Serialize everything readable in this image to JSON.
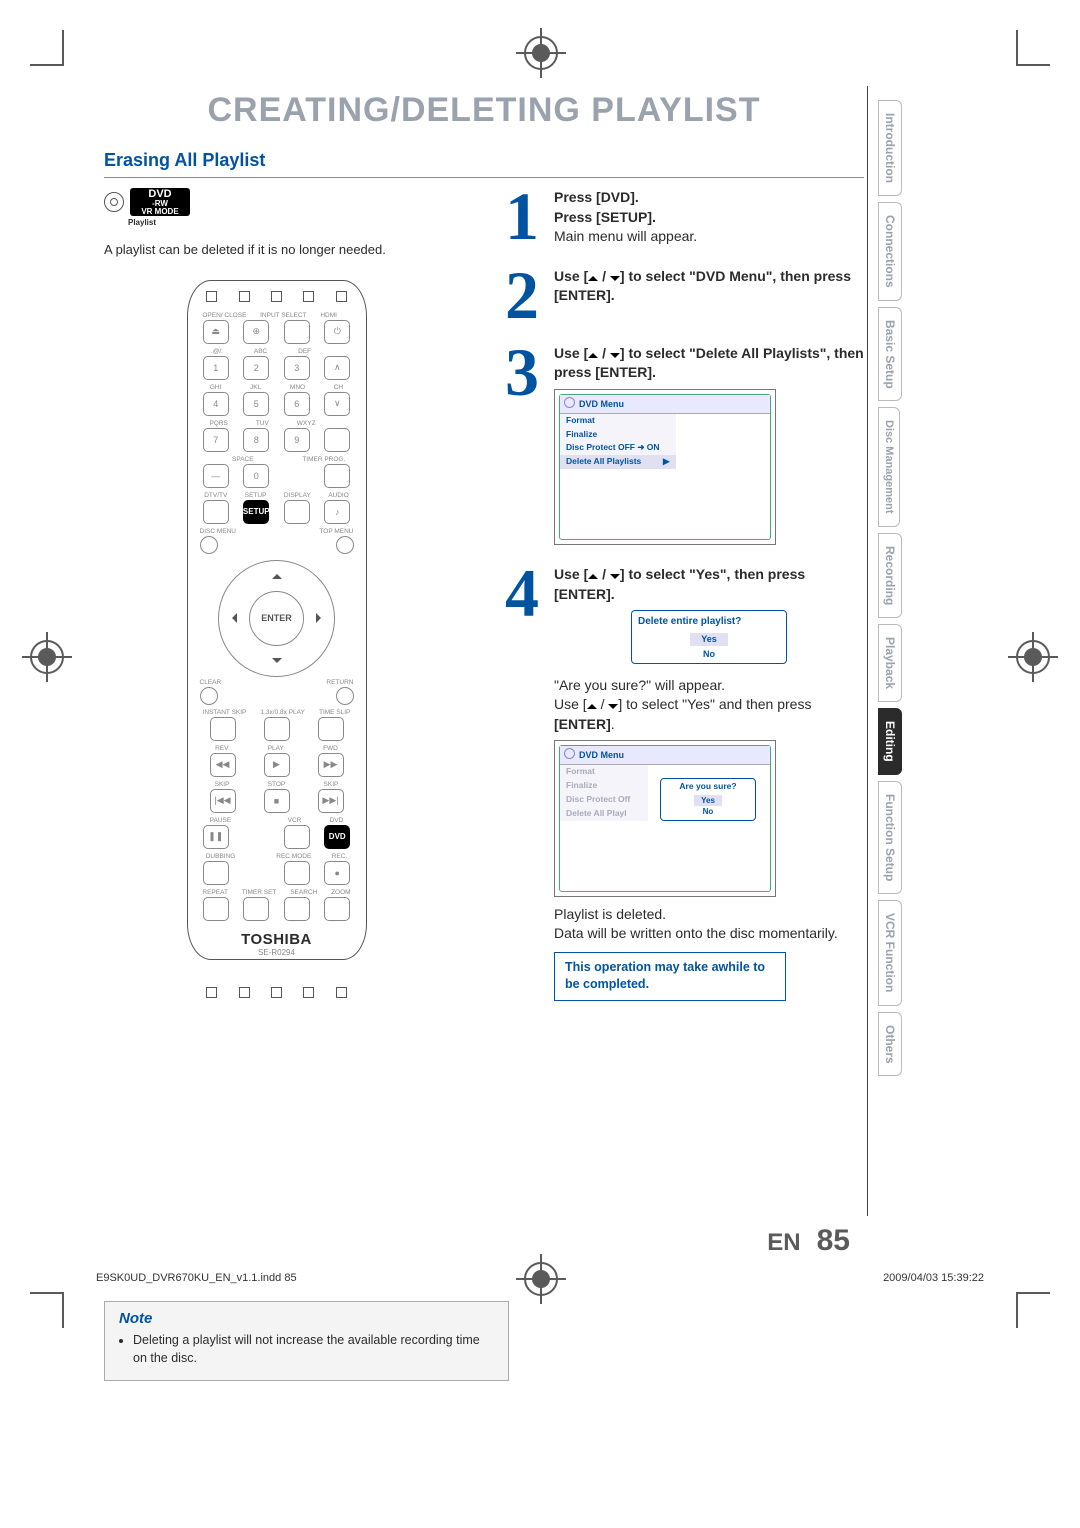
{
  "page_title": "CREATING/DELETING PLAYLIST",
  "section_title": "Erasing All Playlist",
  "disc_badge_top": "DVD",
  "disc_badge_mid": "-RW",
  "disc_badge_bot": "VR MODE",
  "disc_badge_sub": "Playlist",
  "intro_text": "A playlist can be deleted if it is no longer needed.",
  "remote_brand": "TOSHIBA",
  "remote_model": "SE-R0294",
  "remote_enter": "ENTER",
  "remote_labels": {
    "row1": [
      "OPEN/\nCLOSE",
      "INPUT\nSELECT",
      "HDMI",
      ""
    ],
    "row2_sub": [
      ".@/:",
      "ABC",
      "DEF",
      ""
    ],
    "row2": [
      "1",
      "2",
      "3",
      ""
    ],
    "row3_sub": [
      "GHI",
      "JKL",
      "MNO",
      "CH"
    ],
    "row3": [
      "4",
      "5",
      "6",
      ""
    ],
    "row4_sub": [
      "PQRS",
      "TUV",
      "WXYZ",
      ""
    ],
    "row4": [
      "7",
      "8",
      "9",
      ""
    ],
    "row5_sub": [
      "",
      "SPACE",
      "",
      "TIMER\nPROG."
    ],
    "row5": [
      "—",
      "0",
      "",
      ""
    ],
    "row6_sub": [
      "DTV/TV",
      "SETUP",
      "DISPLAY",
      "AUDIO"
    ],
    "row7_sub": [
      "DISC MENU",
      "",
      "",
      "TOP MENU"
    ],
    "dpad_clear": "CLEAR",
    "dpad_return": "RETURN",
    "row8_sub": [
      "INSTANT\nSKIP",
      "1.3x/0.8x\nPLAY",
      "TIME SLIP"
    ],
    "row9_sub": [
      "REV",
      "PLAY",
      "FWD"
    ],
    "row10_sub": [
      "SKIP",
      "STOP",
      "SKIP"
    ],
    "row11_sub": [
      "PAUSE",
      "",
      "VCR",
      "DVD"
    ],
    "row12_sub": [
      "DUBBING",
      "",
      "REC MODE",
      "REC."
    ],
    "row13_sub": [
      "REPEAT",
      "TIMER SET",
      "SEARCH",
      "ZOOM"
    ]
  },
  "step1_line1": "Press [DVD].",
  "step1_line2": "Press [SETUP].",
  "step1_line3": "Main menu will appear.",
  "step2_prefix": "Use [",
  "step2_mid": " / ",
  "step2_suffix1": "] to select \"DVD Menu\", then press ",
  "step2_suffix2": "[ENTER].",
  "step3_prefix": "Use [",
  "step3_suffix1": "] to select \"Delete All Playlists\", then press ",
  "step3_suffix2": "[ENTER].",
  "osd1_title": "DVD Menu",
  "osd1_items": [
    "Format",
    "Finalize",
    "Disc Protect OFF ➜ ON",
    "Delete All Playlists"
  ],
  "step4_prefix": "Use [",
  "step4_suffix1": "] to select \"Yes\", then press ",
  "step4_suffix2": "[ENTER].",
  "osd2_title": "Delete entire playlist?",
  "osd2_yes": "Yes",
  "osd2_no": "No",
  "step4_line4": "\"Are you sure?\" will appear.",
  "step4_line5a": "Use [",
  "step4_line5b": "] to select \"Yes\" and then press",
  "step4_enter": "[ENTER]",
  "osd3_title": "DVD Menu",
  "osd3_items": [
    "Format",
    "Finalize",
    "Disc Protect Off",
    "Delete All Playl"
  ],
  "osd3_popup_title": "Are you sure?",
  "osd3_yes": "Yes",
  "osd3_no": "No",
  "step4_deleted": "Playlist is deleted.",
  "step4_written": "Data will be written onto the disc momentarily.",
  "callout": "This operation may take awhile to be completed.",
  "note_head": "Note",
  "note_item": "Deleting a playlist will not increase the available recording time on the disc.",
  "page_lang": "EN",
  "page_num": "85",
  "footer_left": "E9SK0UD_DVR670KU_EN_v1.1.indd   85",
  "footer_right": "2009/04/03   15:39:22",
  "tabs": [
    "Introduction",
    "Connections",
    "Basic Setup",
    "Disc\nManagement",
    "Recording",
    "Playback",
    "Editing",
    "Function Setup",
    "VCR Function",
    "Others"
  ]
}
